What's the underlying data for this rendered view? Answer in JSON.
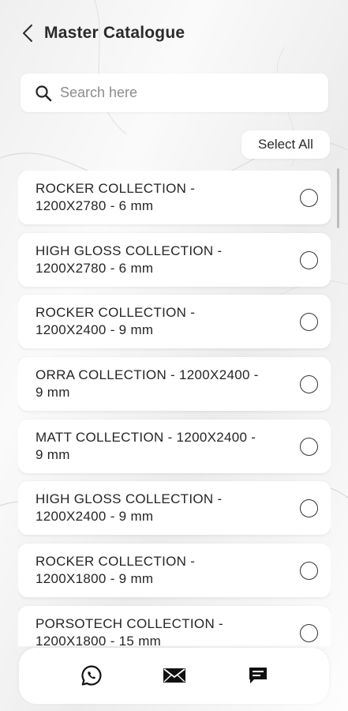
{
  "header": {
    "title": "Master Catalogue"
  },
  "search": {
    "placeholder": "Search here"
  },
  "actions": {
    "select_all_label": "Select All"
  },
  "collections": [
    {
      "line1": "ROCKER COLLECTION -",
      "line2": "1200X2780 - 6 mm"
    },
    {
      "line1": "HIGH GLOSS COLLECTION -",
      "line2": "1200X2780 - 6 mm"
    },
    {
      "line1": "ROCKER COLLECTION -",
      "line2": "1200X2400 - 9 mm"
    },
    {
      "line1": "ORRA COLLECTION - 1200X2400 -",
      "line2": "9 mm"
    },
    {
      "line1": "MATT COLLECTION - 1200X2400 -",
      "line2": "9 mm"
    },
    {
      "line1": "HIGH GLOSS COLLECTION -",
      "line2": "1200X2400 - 9 mm"
    },
    {
      "line1": "ROCKER COLLECTION -",
      "line2": "1200X1800 - 9 mm"
    },
    {
      "line1": "PORSOTECH COLLECTION -",
      "line2": "1200X1800 - 15 mm"
    }
  ],
  "bottom_nav": [
    {
      "icon": "whatsapp-icon"
    },
    {
      "icon": "mail-icon"
    },
    {
      "icon": "chat-icon"
    }
  ]
}
